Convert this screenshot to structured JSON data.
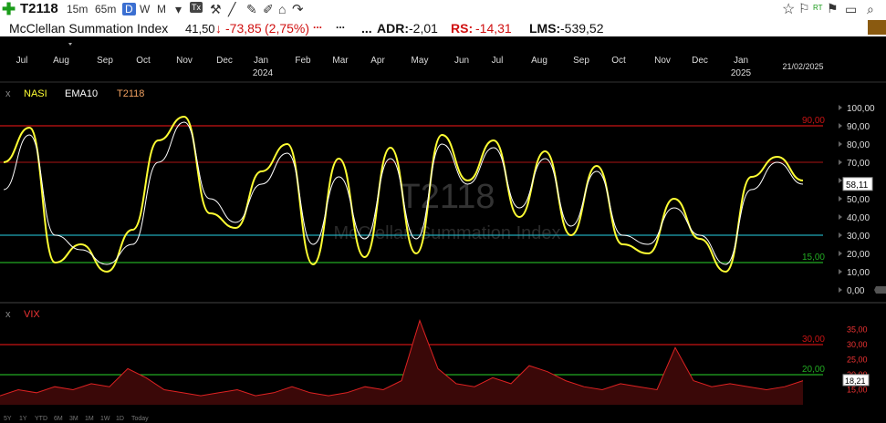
{
  "toolbar": {
    "symbol": "T2118",
    "timeframes": [
      "15m",
      "65m",
      "D",
      "W",
      "M"
    ],
    "selected_timeframe": "D",
    "icons": [
      "add-icon",
      "tools-icon",
      "ruler-icon",
      "pencil-icon",
      "text-icon",
      "brush-icon",
      "layout-icon",
      "dropdown-icon",
      "undo-icon",
      "share-icon",
      "star-icon",
      "flag-icon",
      "alert-icon",
      "search-icon",
      "close-icon"
    ]
  },
  "info": {
    "name": "McClellan Summation Index",
    "price": "41,50",
    "change": "-73,85",
    "change_pct": "(2,75%)",
    "dots1": "...",
    "dots2": "...",
    "dots3": "...",
    "adr_label": "ADR:",
    "adr_value": "-2,01",
    "rs_label": "RS:",
    "rs_value": "-14,31",
    "lms_label": "LMS:",
    "lms_value": "-539,52"
  },
  "time_axis": {
    "labels": [
      "Jul",
      "Aug",
      "Sep",
      "Oct",
      "Nov",
      "Dec",
      "Jan",
      "Feb",
      "Mar",
      "Apr",
      "May",
      "Jun",
      "Jul",
      "Aug",
      "Sep",
      "Oct",
      "Nov",
      "Dec",
      "Jan"
    ],
    "years": [
      "2024",
      "2025"
    ],
    "last_date": "21/02/2025"
  },
  "top_panel": {
    "close_label": "x",
    "legend": [
      "NASI",
      "EMA10",
      "T2118"
    ],
    "watermark_symbol": "T2118",
    "watermark_name": "McClellan Summation Index",
    "y_labels": [
      "100,00",
      "90,00",
      "80,00",
      "70,00",
      "60,00",
      "50,00",
      "40,00",
      "30,00",
      "20,00",
      "10,00",
      "0,00"
    ],
    "last_value": "58,11",
    "line_labels": {
      "high": "90,00",
      "low": "15,00"
    },
    "colors": {
      "nasi": "#ffff33",
      "ema": "#ffffff",
      "line90": "#c81414",
      "line70": "#8a1010",
      "line30": "#20a8b8",
      "line15": "#22aa22"
    }
  },
  "bottom_panel": {
    "close_label": "x",
    "legend": [
      "VIX"
    ],
    "y_labels": [
      "35,00",
      "30,00",
      "25,00",
      "20,00",
      "15,00"
    ],
    "last_value": "18,21",
    "line_labels": {
      "high": "30,00",
      "low": "20,00"
    },
    "bottom_tools": [
      "5Y",
      "1Y",
      "YTD",
      "6M",
      "3M",
      "1M",
      "1W",
      "1D",
      "Today"
    ]
  },
  "chart_data": [
    {
      "type": "line",
      "title": "T2118",
      "x": [
        "Jul",
        "Aug",
        "Sep",
        "Oct",
        "Nov",
        "Dec",
        "Jan",
        "Feb",
        "Mar",
        "Apr",
        "May",
        "Jun",
        "Jul",
        "Aug",
        "Sep",
        "Oct",
        "Nov",
        "Dec",
        "Jan"
      ],
      "ylim": [
        0,
        100
      ],
      "series": [
        {
          "name": "NASI",
          "values": [
            70,
            89,
            15,
            25,
            10,
            33,
            82,
            95,
            42,
            34,
            65,
            80,
            14,
            72,
            18,
            78,
            20,
            85,
            60,
            82,
            40,
            76,
            30,
            68,
            25,
            20,
            50,
            28,
            10,
            62,
            73,
            60
          ]
        },
        {
          "name": "EMA10",
          "values": [
            55,
            85,
            30,
            22,
            14,
            25,
            70,
            92,
            50,
            37,
            58,
            75,
            25,
            62,
            28,
            72,
            28,
            80,
            58,
            78,
            45,
            72,
            35,
            65,
            30,
            25,
            45,
            30,
            14,
            55,
            70,
            58
          ]
        }
      ],
      "hlines": [
        90,
        70,
        30,
        15
      ]
    },
    {
      "type": "area",
      "title": "VIX",
      "ylim": [
        10,
        40
      ],
      "series": [
        {
          "name": "VIX",
          "values": [
            13,
            15,
            14,
            16,
            15,
            17,
            16,
            22,
            19,
            15,
            14,
            13,
            14,
            15,
            13,
            14,
            16,
            14,
            13,
            14,
            16,
            15,
            18,
            38,
            22,
            17,
            16,
            19,
            17,
            23,
            21,
            18,
            16,
            15,
            17,
            16,
            15,
            29,
            18,
            16,
            17,
            16,
            15,
            16,
            18
          ]
        }
      ],
      "hlines": [
        30,
        20
      ]
    }
  ]
}
